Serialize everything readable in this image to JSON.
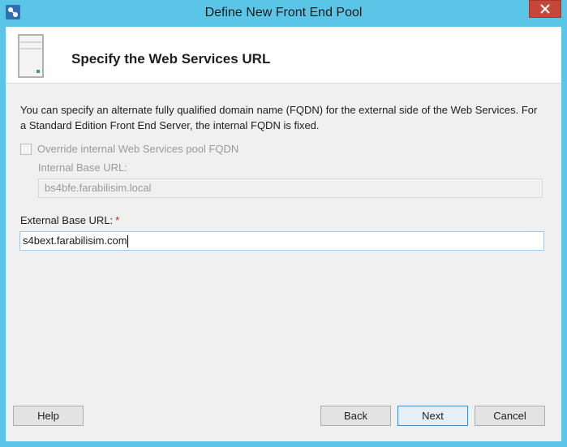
{
  "window": {
    "title": "Define New Front End Pool"
  },
  "header": {
    "heading": "Specify the Web Services URL"
  },
  "body": {
    "description": "You can specify an alternate fully qualified domain name (FQDN) for the external side of the Web Services. For a Standard Edition Front End Server, the internal FQDN is fixed.",
    "override_checkbox": {
      "label": "Override internal Web Services pool FQDN",
      "checked": false,
      "enabled": false
    },
    "internal_base_url": {
      "label": "Internal Base URL:",
      "value": "bs4bfe.farabilisim.local",
      "enabled": false
    },
    "external_base_url": {
      "label": "External Base URL:",
      "required_marker": "*",
      "value": "s4bext.farabilisim.com"
    }
  },
  "buttons": {
    "help": "Help",
    "back": "Back",
    "next": "Next",
    "cancel": "Cancel"
  },
  "icons": {
    "app": "skype-for-business-topology-icon",
    "close": "close-icon",
    "header": "server-icon"
  },
  "colors": {
    "titlebar": "#5bc5e8",
    "close_button": "#c7463a",
    "required": "#c8281f"
  }
}
